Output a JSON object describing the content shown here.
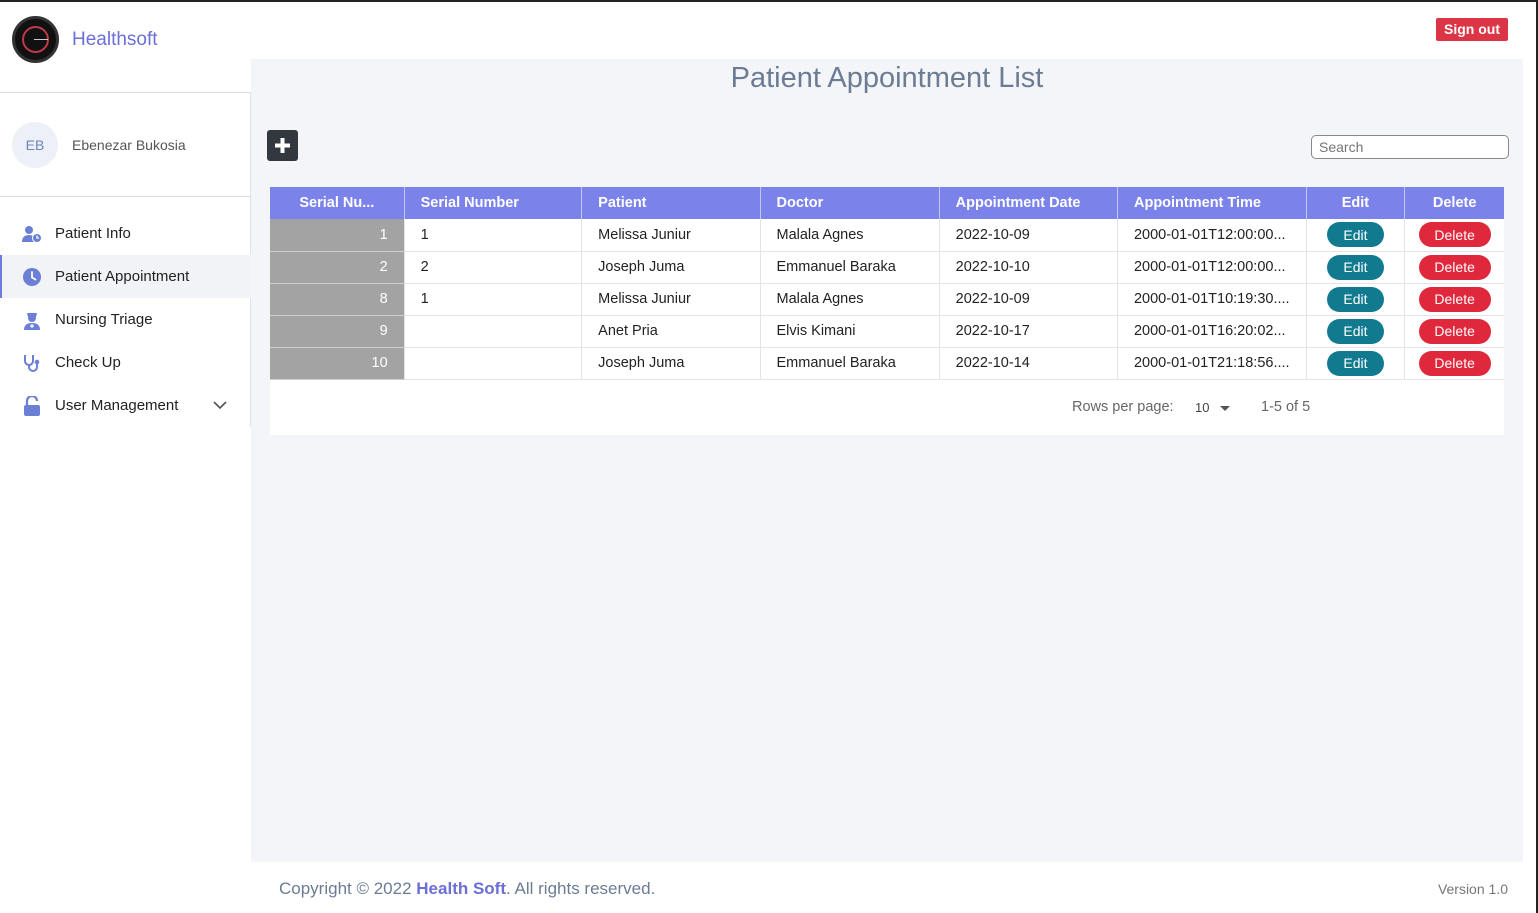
{
  "app": {
    "name": "Healthsoft",
    "signout_label": "Sign out"
  },
  "user": {
    "initials": "EB",
    "name": "Ebenezar Bukosia"
  },
  "nav": {
    "items": [
      {
        "label": "Patient Info",
        "icon": "patient-info-icon"
      },
      {
        "label": "Patient Appointment",
        "icon": "clock-icon",
        "active": true
      },
      {
        "label": "Nursing Triage",
        "icon": "nurse-icon"
      },
      {
        "label": "Check Up",
        "icon": "stethoscope-icon"
      },
      {
        "label": "User Management",
        "icon": "unlock-icon",
        "expandable": true
      }
    ]
  },
  "page": {
    "title": "Patient Appointment List",
    "search_placeholder": "Search"
  },
  "table": {
    "columns": [
      "Serial Nu...",
      "Serial Number",
      "Patient",
      "Doctor",
      "Appointment Date",
      "Appointment Time",
      "Edit",
      "Delete"
    ],
    "rows": [
      {
        "id": "1",
        "serial": "1",
        "patient": "Melissa Juniur",
        "doctor": "Malala Agnes",
        "date": "2022-10-09",
        "time": "2000-01-01T12:00:00...",
        "edit": "Edit",
        "delete": "Delete"
      },
      {
        "id": "2",
        "serial": "2",
        "patient": "Joseph Juma",
        "doctor": "Emmanuel Baraka",
        "date": "2022-10-10",
        "time": "2000-01-01T12:00:00...",
        "edit": "Edit",
        "delete": "Delete"
      },
      {
        "id": "8",
        "serial": "1",
        "patient": "Melissa Juniur",
        "doctor": "Malala Agnes",
        "date": "2022-10-09",
        "time": "2000-01-01T10:19:30....",
        "edit": "Edit",
        "delete": "Delete"
      },
      {
        "id": "9",
        "serial": "",
        "patient": "Anet Pria",
        "doctor": "Elvis Kimani",
        "date": "2022-10-17",
        "time": "2000-01-01T16:20:02...",
        "edit": "Edit",
        "delete": "Delete"
      },
      {
        "id": "10",
        "serial": "",
        "patient": "Joseph Juma",
        "doctor": "Emmanuel Baraka",
        "date": "2022-10-14",
        "time": "2000-01-01T21:18:56....",
        "edit": "Edit",
        "delete": "Delete"
      }
    ],
    "pagination": {
      "rows_per_page_label": "Rows per page:",
      "rows_per_page": "10",
      "range": "1-5 of 5"
    }
  },
  "footer": {
    "copyright_prefix": "Copyright © 2022 ",
    "copyright_brand": "Health Soft",
    "copyright_suffix": ". All rights reserved.",
    "version": "Version 1.0"
  },
  "colors": {
    "accent": "#7b83eb",
    "brand": "#6b6fd6",
    "danger": "#dc3545",
    "edit": "#127a8f"
  }
}
